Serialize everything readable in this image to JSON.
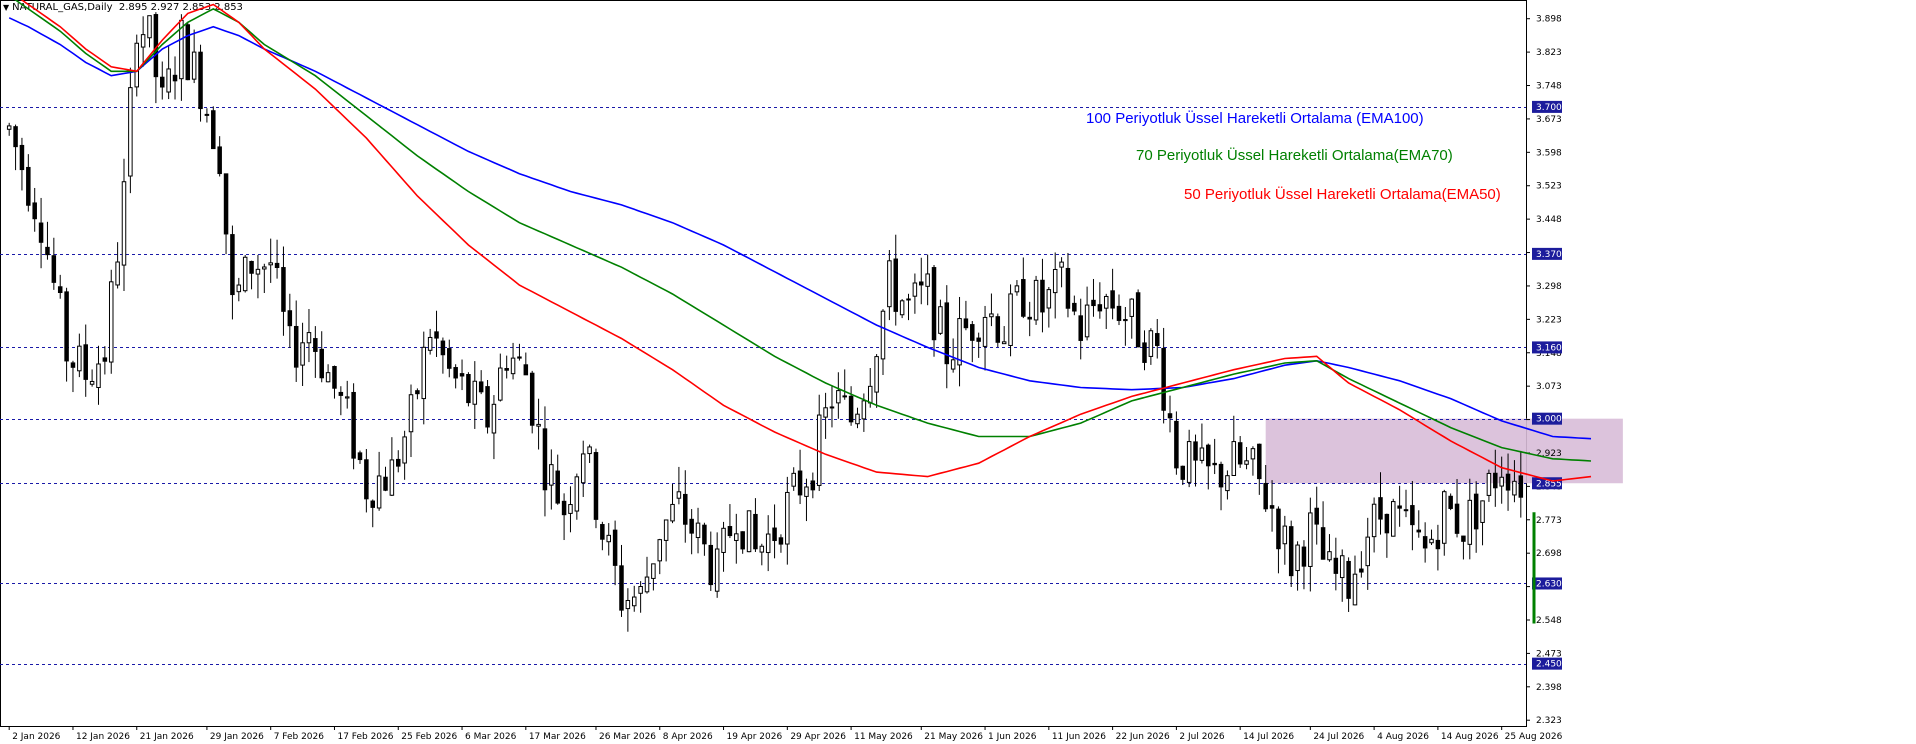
{
  "header": {
    "symbol": "NATURAL_GAS,Daily",
    "ohlc": "2.895 2.927 2.853 2.853"
  },
  "colors": {
    "ema100": "#0000ff",
    "ema70": "#008000",
    "ema50": "#ff0000",
    "level_line": "#1a1aa8",
    "level_badge": "#1c1c9c",
    "zone": "#d8bcd8"
  },
  "legend": {
    "ema100": "100 Periyotluk Üssel Hareketli Ortalama (EMA100)",
    "ema70": "70 Periyotluk Üssel Hareketli Ortalama(EMA70)",
    "ema50": "50 Periyotluk Üssel Hareketli Ortalama(EMA50)"
  },
  "chart_data": {
    "type": "candlestick",
    "title": "NATURAL_GAS,Daily",
    "ylim": [
      2.31,
      3.94
    ],
    "y_ticks": [
      "3.898",
      "3.823",
      "3.748",
      "3.673",
      "3.598",
      "3.523",
      "3.448",
      "3.373",
      "3.298",
      "3.223",
      "3.148",
      "3.073",
      "2.998",
      "2.923",
      "2.848",
      "2.773",
      "2.698",
      "2.623",
      "2.548",
      "2.473",
      "2.398",
      "2.323"
    ],
    "x_tick_labels": [
      "2 Jan 2026",
      "12 Jan 2026",
      "21 Jan 2026",
      "29 Jan 2026",
      "7 Feb 2026",
      "17 Feb 2026",
      "25 Feb 2026",
      "6 Mar 2026",
      "17 Mar 2026",
      "26 Mar 2026",
      "8 Apr 2026",
      "19 Apr 2026",
      "29 Apr 2026",
      "11 May 2026",
      "21 May 2026",
      "1 Jun 2026",
      "11 Jun 2026",
      "22 Jun 2026",
      "2 Jul 2026",
      "14 Jul 2026",
      "24 Jul 2026",
      "4 Aug 2026",
      "14 Aug 2026",
      "25 Aug 2026"
    ],
    "horizontal_levels": [
      "3.700",
      "3.370",
      "3.160",
      "3.000",
      "2.855",
      "2.630",
      "2.450"
    ],
    "zone": {
      "from_index": 197,
      "to_index": 253,
      "low": 2.855,
      "high": 3.0
    },
    "series": [
      {
        "name": "EMA100",
        "anchors": [
          [
            0,
            3.9
          ],
          [
            3,
            3.88
          ],
          [
            8,
            3.84
          ],
          [
            12,
            3.8
          ],
          [
            16,
            3.77
          ],
          [
            20,
            3.78
          ],
          [
            24,
            3.83
          ],
          [
            28,
            3.86
          ],
          [
            32,
            3.88
          ],
          [
            36,
            3.86
          ],
          [
            40,
            3.83
          ],
          [
            48,
            3.78
          ],
          [
            56,
            3.72
          ],
          [
            64,
            3.66
          ],
          [
            72,
            3.6
          ],
          [
            80,
            3.55
          ],
          [
            88,
            3.51
          ],
          [
            96,
            3.48
          ],
          [
            104,
            3.44
          ],
          [
            112,
            3.39
          ],
          [
            120,
            3.33
          ],
          [
            128,
            3.27
          ],
          [
            136,
            3.21
          ],
          [
            144,
            3.16
          ],
          [
            152,
            3.115
          ],
          [
            160,
            3.085
          ],
          [
            168,
            3.07
          ],
          [
            176,
            3.065
          ],
          [
            184,
            3.07
          ],
          [
            192,
            3.09
          ],
          [
            200,
            3.12
          ],
          [
            205,
            3.13
          ],
          [
            210,
            3.115
          ],
          [
            218,
            3.085
          ],
          [
            226,
            3.045
          ],
          [
            234,
            2.995
          ],
          [
            242,
            2.96
          ],
          [
            248,
            2.955
          ]
        ]
      },
      {
        "name": "EMA70",
        "anchors": [
          [
            0,
            3.95
          ],
          [
            3,
            3.92
          ],
          [
            8,
            3.87
          ],
          [
            12,
            3.82
          ],
          [
            16,
            3.78
          ],
          [
            20,
            3.78
          ],
          [
            24,
            3.84
          ],
          [
            28,
            3.89
          ],
          [
            32,
            3.92
          ],
          [
            36,
            3.89
          ],
          [
            40,
            3.84
          ],
          [
            48,
            3.77
          ],
          [
            56,
            3.68
          ],
          [
            64,
            3.59
          ],
          [
            72,
            3.51
          ],
          [
            80,
            3.44
          ],
          [
            88,
            3.39
          ],
          [
            96,
            3.34
          ],
          [
            104,
            3.28
          ],
          [
            112,
            3.21
          ],
          [
            120,
            3.14
          ],
          [
            128,
            3.08
          ],
          [
            136,
            3.03
          ],
          [
            144,
            2.99
          ],
          [
            152,
            2.96
          ],
          [
            160,
            2.96
          ],
          [
            168,
            2.99
          ],
          [
            176,
            3.04
          ],
          [
            184,
            3.07
          ],
          [
            192,
            3.1
          ],
          [
            200,
            3.125
          ],
          [
            205,
            3.13
          ],
          [
            210,
            3.09
          ],
          [
            218,
            3.035
          ],
          [
            226,
            2.98
          ],
          [
            234,
            2.935
          ],
          [
            242,
            2.91
          ],
          [
            248,
            2.905
          ]
        ]
      },
      {
        "name": "EMA50",
        "anchors": [
          [
            0,
            3.96
          ],
          [
            3,
            3.93
          ],
          [
            8,
            3.88
          ],
          [
            12,
            3.83
          ],
          [
            16,
            3.79
          ],
          [
            20,
            3.78
          ],
          [
            24,
            3.85
          ],
          [
            28,
            3.91
          ],
          [
            32,
            3.93
          ],
          [
            36,
            3.89
          ],
          [
            40,
            3.83
          ],
          [
            48,
            3.74
          ],
          [
            56,
            3.63
          ],
          [
            64,
            3.5
          ],
          [
            72,
            3.39
          ],
          [
            80,
            3.3
          ],
          [
            88,
            3.24
          ],
          [
            96,
            3.18
          ],
          [
            104,
            3.11
          ],
          [
            112,
            3.03
          ],
          [
            120,
            2.97
          ],
          [
            128,
            2.92
          ],
          [
            136,
            2.88
          ],
          [
            144,
            2.87
          ],
          [
            152,
            2.9
          ],
          [
            160,
            2.96
          ],
          [
            168,
            3.01
          ],
          [
            176,
            3.05
          ],
          [
            184,
            3.08
          ],
          [
            192,
            3.11
          ],
          [
            200,
            3.135
          ],
          [
            205,
            3.14
          ],
          [
            210,
            3.08
          ],
          [
            218,
            3.02
          ],
          [
            226,
            2.95
          ],
          [
            234,
            2.89
          ],
          [
            242,
            2.86
          ],
          [
            248,
            2.87
          ]
        ]
      }
    ],
    "price_anchors": [
      [
        0,
        3.65
      ],
      [
        5,
        3.45
      ],
      [
        9,
        3.15
      ],
      [
        12,
        3.1
      ],
      [
        15,
        3.15
      ],
      [
        18,
        3.5
      ],
      [
        20,
        3.9
      ],
      [
        22,
        3.85
      ],
      [
        24,
        3.7
      ],
      [
        27,
        3.85
      ],
      [
        30,
        3.75
      ],
      [
        33,
        3.6
      ],
      [
        35,
        3.25
      ],
      [
        38,
        3.35
      ],
      [
        41,
        3.35
      ],
      [
        44,
        3.15
      ],
      [
        47,
        3.2
      ],
      [
        50,
        3.1
      ],
      [
        53,
        3.0
      ],
      [
        56,
        2.85
      ],
      [
        60,
        2.88
      ],
      [
        63,
        3.0
      ],
      [
        66,
        3.2
      ],
      [
        69,
        3.1
      ],
      [
        72,
        3.05
      ],
      [
        75,
        3.0
      ],
      [
        78,
        3.15
      ],
      [
        81,
        3.1
      ],
      [
        84,
        2.9
      ],
      [
        87,
        2.8
      ],
      [
        90,
        2.95
      ],
      [
        93,
        2.75
      ],
      [
        96,
        2.6
      ],
      [
        99,
        2.6
      ],
      [
        102,
        2.75
      ],
      [
        105,
        2.8
      ],
      [
        108,
        2.73
      ],
      [
        111,
        2.65
      ],
      [
        114,
        2.8
      ],
      [
        117,
        2.7
      ],
      [
        120,
        2.75
      ],
      [
        123,
        2.83
      ],
      [
        126,
        2.9
      ],
      [
        129,
        3.05
      ],
      [
        132,
        3.0
      ],
      [
        135,
        3.12
      ],
      [
        138,
        3.3
      ],
      [
        141,
        3.25
      ],
      [
        144,
        3.28
      ],
      [
        147,
        3.15
      ],
      [
        150,
        3.2
      ],
      [
        153,
        3.25
      ],
      [
        156,
        3.2
      ],
      [
        159,
        3.28
      ],
      [
        162,
        3.25
      ],
      [
        165,
        3.3
      ],
      [
        168,
        3.2
      ],
      [
        171,
        3.28
      ],
      [
        174,
        3.25
      ],
      [
        177,
        3.2
      ],
      [
        180,
        3.15
      ],
      [
        183,
        2.92
      ],
      [
        186,
        2.88
      ],
      [
        189,
        2.87
      ],
      [
        192,
        2.9
      ],
      [
        195,
        2.88
      ],
      [
        198,
        2.8
      ],
      [
        201,
        2.68
      ],
      [
        204,
        2.75
      ],
      [
        207,
        2.65
      ],
      [
        210,
        2.63
      ],
      [
        213,
        2.75
      ],
      [
        216,
        2.8
      ],
      [
        219,
        2.75
      ],
      [
        222,
        2.7
      ],
      [
        225,
        2.8
      ],
      [
        228,
        2.76
      ],
      [
        231,
        2.82
      ],
      [
        234,
        2.9
      ],
      [
        237,
        2.86
      ]
    ],
    "candle_count": 238
  }
}
